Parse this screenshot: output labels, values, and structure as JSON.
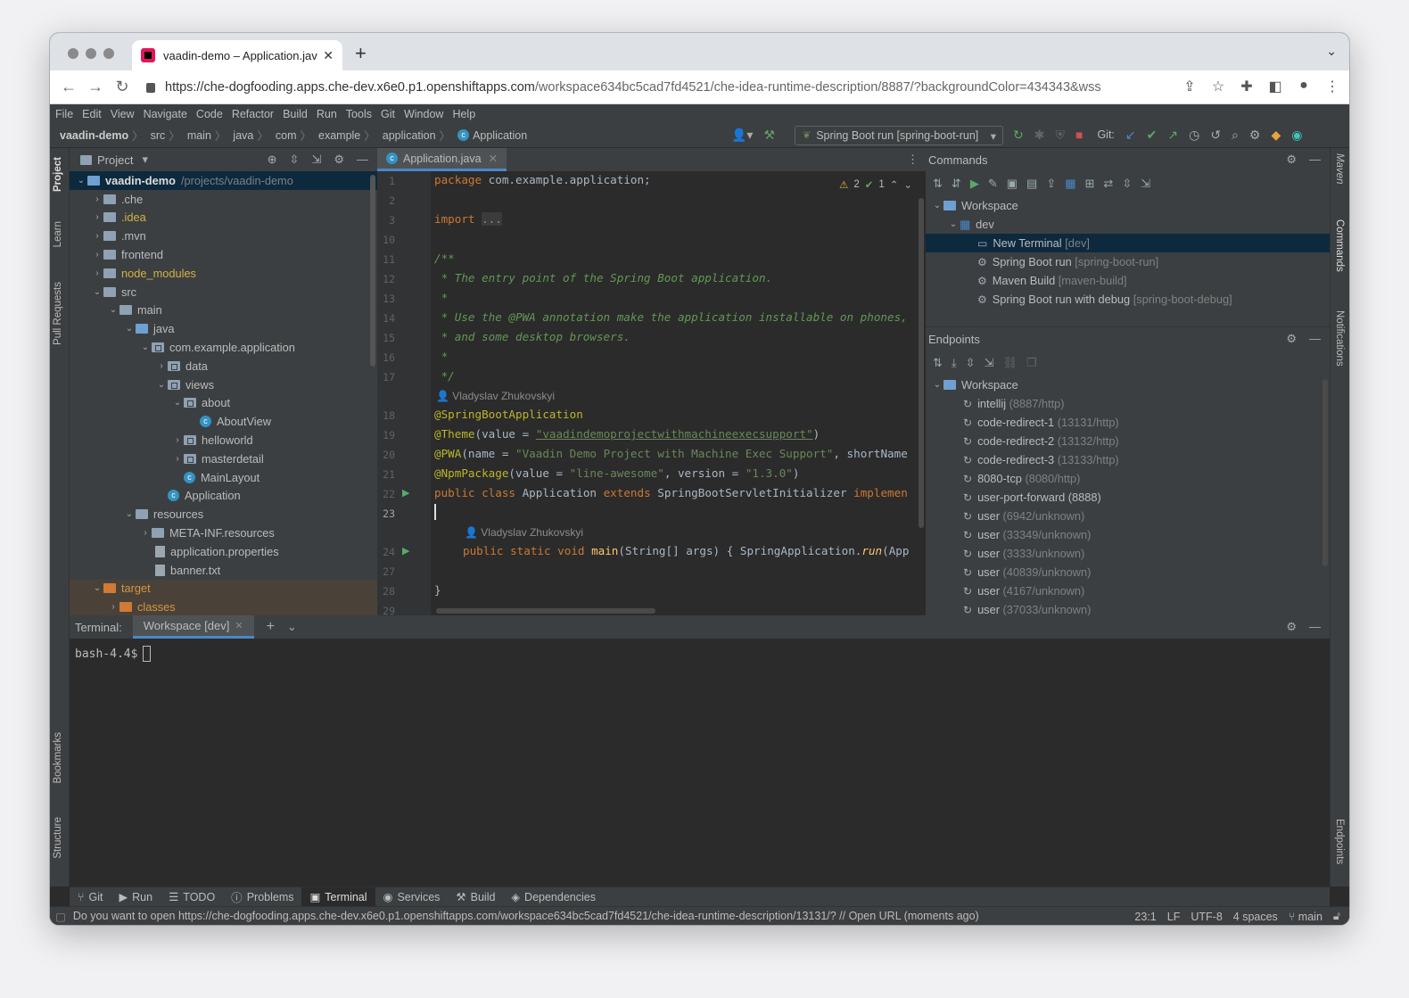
{
  "browser": {
    "tab_title": "vaadin-demo – Application.java",
    "url_host": "https://che-dogfooding.apps.che-dev.x6e0.p1.openshiftapps.com",
    "url_path": "/workspace634bc5cad7fd4521/che-idea-runtime-description/8887/?backgroundColor=434343&wss"
  },
  "menu": [
    "File",
    "Edit",
    "View",
    "Navigate",
    "Code",
    "Refactor",
    "Build",
    "Run",
    "Tools",
    "Git",
    "Window",
    "Help"
  ],
  "breadcrumb": [
    "vaadin-demo",
    "src",
    "main",
    "java",
    "com",
    "example",
    "application",
    "Application"
  ],
  "run_config": "Spring Boot run [spring-boot-run]",
  "git_label": "Git:",
  "left_stripe": [
    "Project",
    "Learn",
    "Pull Requests",
    "Bookmarks",
    "Structure"
  ],
  "right_stripe": [
    "Maven",
    "Commands",
    "Notifications",
    "Endpoints"
  ],
  "project": {
    "title": "Project",
    "root": "vaadin-demo",
    "root_path": "/projects/vaadin-demo",
    "nodes": [
      ".che",
      ".idea",
      ".mvn",
      "frontend",
      "node_modules",
      "src",
      "main",
      "java",
      "com.example.application",
      "data",
      "views",
      "about",
      "AboutView",
      "helloworld",
      "masterdetail",
      "MainLayout",
      "Application",
      "resources",
      "META-INF.resources",
      "application.properties",
      "banner.txt",
      "target",
      "classes"
    ]
  },
  "editor": {
    "tab": "Application.java",
    "line_numbers": [
      "1",
      "2",
      "3",
      "10",
      "11",
      "12",
      "13",
      "14",
      "15",
      "16",
      "17",
      "18",
      "19",
      "20",
      "21",
      "22",
      "23",
      "24",
      "27",
      "28",
      "29"
    ],
    "warnings": "2",
    "checks": "1",
    "author": "Vladyslav Zhukovskyi",
    "code": {
      "l1a": "package ",
      "l1b": "com.example.application;",
      "l3a": "import ",
      "l3b": "...",
      "c11": "/**",
      "c12": " * The entry point of the Spring Boot application.",
      "c13": " *",
      "c14": " * Use the @PWA annotation make the application installable on phones,",
      "c15": " * and some desktop browsers.",
      "c16": " *",
      "c17": " */",
      "a18": "@SpringBootApplication",
      "a19": "@Theme",
      "b19": "(value = ",
      "s19": "\"vaadindemoprojectwithmachineexecsupport\"",
      "e19": ")",
      "a20": "@PWA",
      "b20": "(name = ",
      "s20": "\"Vaadin Demo Project with Machine Exec Support\"",
      "e20": ", shortName",
      "a21": "@NpmPackage",
      "b21": "(value = ",
      "s21": "\"line-awesome\"",
      "c21": ", version = ",
      "d21": "\"1.3.0\"",
      "e21": ")",
      "k22a": "public class ",
      "n22": "Application ",
      "k22b": "extends ",
      "t22": "SpringBootServletInitializer ",
      "k22c": "implemen",
      "k24": "public static void ",
      "f24": "main",
      "p24": "(String[] args) { SpringApplication.",
      "r24": "run",
      "q24": "(App",
      "l28": "}"
    }
  },
  "commands": {
    "title": "Commands",
    "workspace": "Workspace",
    "group": "dev",
    "items": [
      {
        "label": "New Terminal",
        "tag": "[dev]"
      },
      {
        "label": "Spring Boot run",
        "tag": "[spring-boot-run]"
      },
      {
        "label": "Maven Build",
        "tag": "[maven-build]"
      },
      {
        "label": "Spring Boot run with debug",
        "tag": "[spring-boot-debug]"
      }
    ]
  },
  "endpoints": {
    "title": "Endpoints",
    "workspace": "Workspace",
    "items": [
      {
        "label": "intellij",
        "tag": "(8887/http)"
      },
      {
        "label": "code-redirect-1",
        "tag": "(13131/http)"
      },
      {
        "label": "code-redirect-2",
        "tag": "(13132/http)"
      },
      {
        "label": "code-redirect-3",
        "tag": "(13133/http)"
      },
      {
        "label": "8080-tcp",
        "tag": "(8080/http)"
      },
      {
        "label": "user-port-forward (8888)",
        "tag": ""
      },
      {
        "label": "user",
        "tag": "(6942/unknown)"
      },
      {
        "label": "user",
        "tag": "(33349/unknown)"
      },
      {
        "label": "user",
        "tag": "(3333/unknown)"
      },
      {
        "label": "user",
        "tag": "(40839/unknown)"
      },
      {
        "label": "user",
        "tag": "(4167/unknown)"
      },
      {
        "label": "user",
        "tag": "(37033/unknown)"
      }
    ]
  },
  "terminal": {
    "label": "Terminal:",
    "tab": "Workspace [dev]",
    "prompt": "bash-4.4$"
  },
  "bottom_tabs": [
    "Git",
    "Run",
    "TODO",
    "Problems",
    "Terminal",
    "Services",
    "Build",
    "Dependencies"
  ],
  "status": {
    "message": "Do you want to open https://che-dogfooding.apps.che-dev.x6e0.p1.openshiftapps.com/workspace634bc5cad7fd4521/che-idea-runtime-description/13131/? // Open URL (moments ago)",
    "position": "23:1",
    "line_sep": "LF",
    "encoding": "UTF-8",
    "indent": "4 spaces",
    "branch": "main"
  }
}
